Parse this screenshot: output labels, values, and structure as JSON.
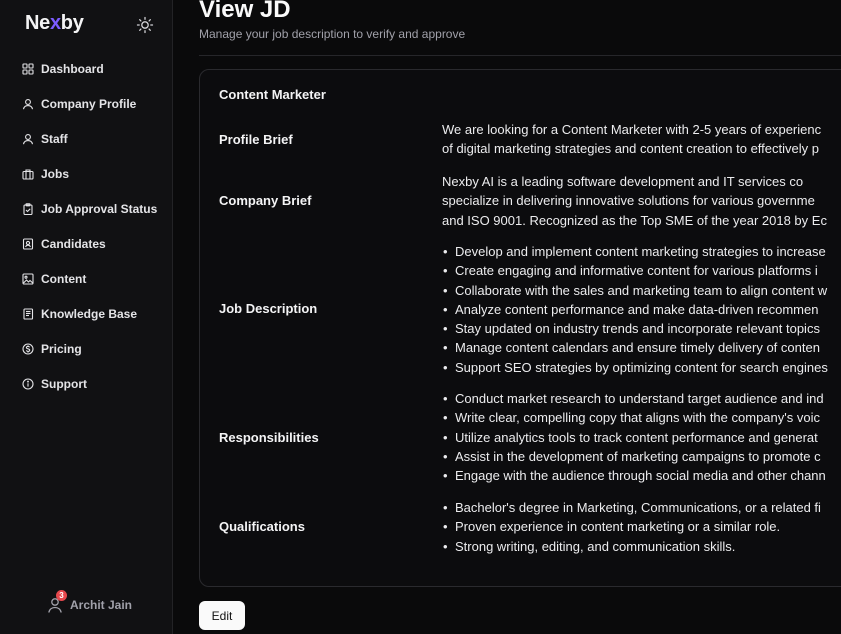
{
  "brand": {
    "prefix": "Ne",
    "accent": "x",
    "suffix": "by",
    "accent_color": "#7c5cff"
  },
  "sidebar": {
    "items": [
      {
        "label": "Dashboard",
        "icon": "dashboard-icon"
      },
      {
        "label": "Company Profile",
        "icon": "user-icon"
      },
      {
        "label": "Staff",
        "icon": "user-icon"
      },
      {
        "label": "Jobs",
        "icon": "briefcase-icon"
      },
      {
        "label": "Job Approval Status",
        "icon": "clipboard-check-icon"
      },
      {
        "label": "Candidates",
        "icon": "id-badge-icon"
      },
      {
        "label": "Content",
        "icon": "image-icon"
      },
      {
        "label": "Knowledge Base",
        "icon": "book-icon"
      },
      {
        "label": "Pricing",
        "icon": "dollar-circle-icon"
      },
      {
        "label": "Support",
        "icon": "info-icon"
      }
    ],
    "user": {
      "name": "Archit Jain",
      "notifications": "3"
    }
  },
  "page": {
    "title": "View JD",
    "subtitle": "Manage your job description to verify and approve"
  },
  "jd": {
    "job_title": "Content Marketer",
    "profile_brief_label": "Profile Brief",
    "profile_brief": [
      "We are looking for a Content Marketer with 2-5 years of experienc",
      "of digital marketing strategies and content creation to effectively p"
    ],
    "company_brief_label": "Company Brief",
    "company_brief": [
      "Nexby AI is a leading software development and IT services co",
      "specialize in delivering innovative solutions for various governme",
      "and ISO 9001. Recognized as the Top SME of the year 2018 by Ec"
    ],
    "job_description_label": "Job Description",
    "job_description": [
      "Develop and implement content marketing strategies to increase",
      "Create engaging and informative content for various platforms i",
      "Collaborate with the sales and marketing team to align content w",
      "Analyze content performance and make data-driven recommen",
      "Stay updated on industry trends and incorporate relevant topics",
      "Manage content calendars and ensure timely delivery of conten",
      "Support SEO strategies by optimizing content for search engines"
    ],
    "responsibilities_label": "Responsibilities",
    "responsibilities": [
      "Conduct market research to understand target audience and ind",
      "Write clear, compelling copy that aligns with the company's voic",
      "Utilize analytics tools to track content performance and generat",
      "Assist in the development of marketing campaigns to promote c",
      "Engage with the audience through social media and other chann"
    ],
    "qualifications_label": "Qualifications",
    "qualifications": [
      "Bachelor's degree in Marketing, Communications, or a related fi",
      "Proven experience in content marketing or a similar role.",
      "Strong writing, editing, and communication skills."
    ]
  },
  "actions": {
    "edit_label": "Edit"
  }
}
